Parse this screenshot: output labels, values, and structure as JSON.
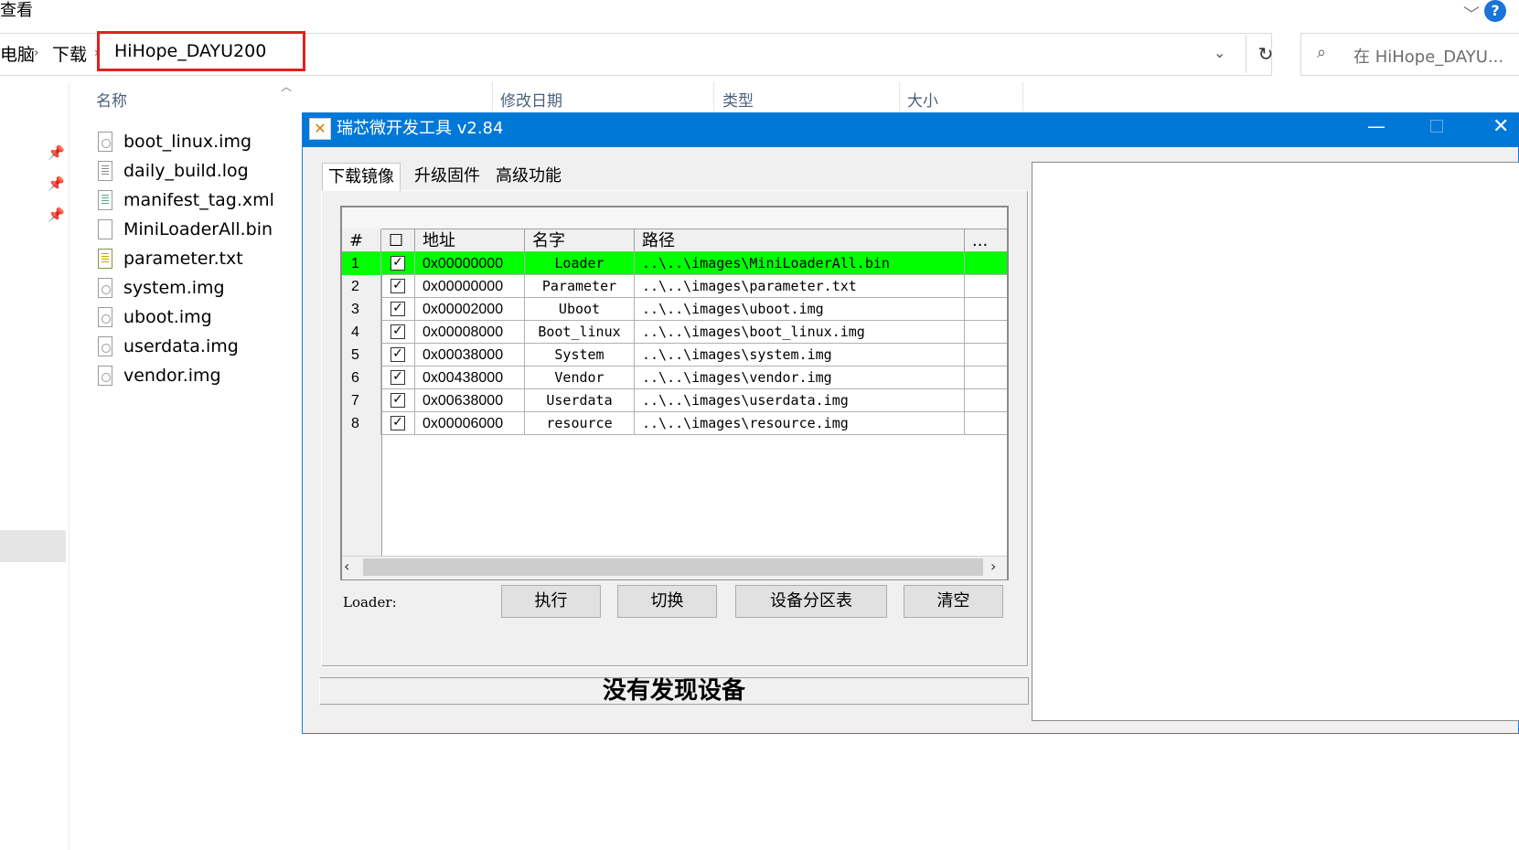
{
  "explorer": {
    "menu_view": "查看",
    "breadcrumb": {
      "pc": "电脑",
      "downloads": "下载",
      "current": "HiHope_DAYU200"
    },
    "search_placeholder": "在 HiHope_DAYU...",
    "columns": {
      "name": "名称",
      "modified": "修改日期",
      "type": "类型",
      "size": "大小"
    },
    "files": [
      {
        "name": "boot_linux.img",
        "icon": "disk-image-icon"
      },
      {
        "name": "daily_build.log",
        "icon": "text-document-icon"
      },
      {
        "name": "manifest_tag.xml",
        "icon": "xml-document-icon"
      },
      {
        "name": "MiniLoaderAll.bin",
        "icon": "blank-file-icon"
      },
      {
        "name": "parameter.txt",
        "icon": "notepad-icon"
      },
      {
        "name": "system.img",
        "icon": "disk-image-icon"
      },
      {
        "name": "uboot.img",
        "icon": "disk-image-icon"
      },
      {
        "name": "userdata.img",
        "icon": "disk-image-icon"
      },
      {
        "name": "vendor.img",
        "icon": "disk-image-icon"
      }
    ]
  },
  "tool": {
    "title": "瑞芯微开发工具 v2.84",
    "tabs": [
      "下载镜像",
      "升级固件",
      "高级功能"
    ],
    "grid_headers": {
      "num": "#",
      "check": "☐",
      "address": "地址",
      "name": "名字",
      "path": "路径",
      "more": "..."
    },
    "rows": [
      {
        "num": "1",
        "checked": "✓",
        "address": "0x00000000",
        "name": "Loader",
        "path": "..\\..\\images\\MiniLoaderAll.bin",
        "selected": true
      },
      {
        "num": "2",
        "checked": "✓",
        "address": "0x00000000",
        "name": "Parameter",
        "path": "..\\..\\images\\parameter.txt"
      },
      {
        "num": "3",
        "checked": "✓",
        "address": "0x00002000",
        "name": "Uboot",
        "path": "..\\..\\images\\uboot.img"
      },
      {
        "num": "4",
        "checked": "✓",
        "address": "0x00008000",
        "name": "Boot_linux",
        "path": "..\\..\\images\\boot_linux.img"
      },
      {
        "num": "5",
        "checked": "✓",
        "address": "0x00038000",
        "name": "System",
        "path": "..\\..\\images\\system.img"
      },
      {
        "num": "6",
        "checked": "✓",
        "address": "0x00438000",
        "name": "Vendor",
        "path": "..\\..\\images\\vendor.img"
      },
      {
        "num": "7",
        "checked": "✓",
        "address": "0x00638000",
        "name": "Userdata",
        "path": "..\\..\\images\\userdata.img"
      },
      {
        "num": "8",
        "checked": "✓",
        "address": "0x00006000",
        "name": "resource",
        "path": "..\\..\\images\\resource.img"
      }
    ],
    "loader_label": "Loader:",
    "buttons": {
      "execute": "执行",
      "switch": "切换",
      "partition_table": "设备分区表",
      "clear": "清空"
    },
    "status": "没有发现设备"
  },
  "colors": {
    "titlebar": "#0078d7",
    "selected_row": "#00ff00",
    "highlight_box": "#e02020"
  }
}
